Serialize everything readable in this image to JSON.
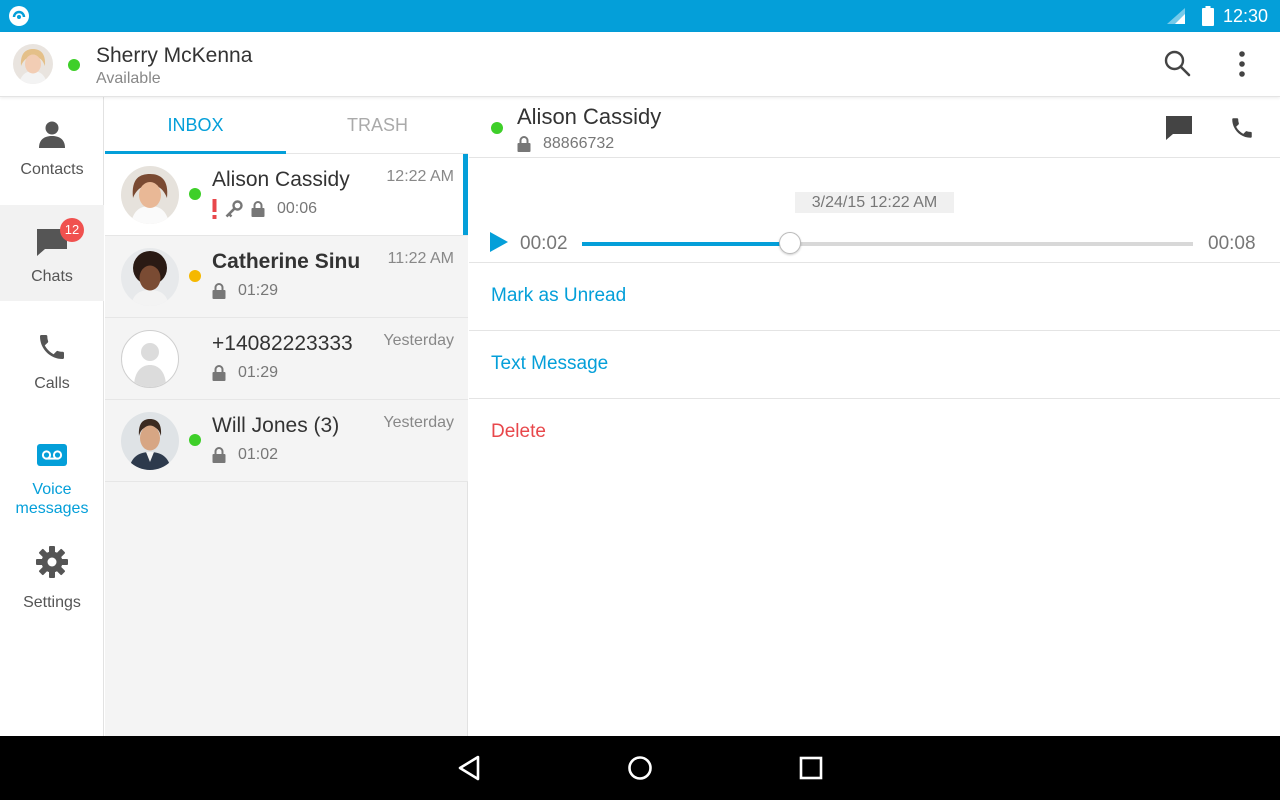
{
  "status_bar": {
    "time": "12:30",
    "app_logo_icon": "app-logo-icon",
    "signal_icon": "signal-icon",
    "battery_icon": "battery-icon"
  },
  "header": {
    "user_name": "Sherry McKenna",
    "user_status": "Available",
    "presence_color": "#3ecf29",
    "search_icon": "search-icon",
    "menu_icon": "overflow-menu-icon"
  },
  "nav": {
    "contacts": "Contacts",
    "chats": "Chats",
    "chats_badge": "12",
    "calls": "Calls",
    "voice_line1": "Voice",
    "voice_line2": "messages",
    "settings": "Settings"
  },
  "tabs": {
    "inbox": "INBOX",
    "trash": "TRASH",
    "active": "INBOX"
  },
  "messages": [
    {
      "name": "Alison Cassidy",
      "time": "12:22 AM",
      "duration": "00:06",
      "presence": "#3ecf29",
      "urgent": true,
      "private": true,
      "selected": true,
      "unread": false
    },
    {
      "name": "Catherine Sinu",
      "time": "11:22 AM",
      "duration": "01:29",
      "presence": "#f5b800",
      "urgent": false,
      "private": false,
      "selected": false,
      "unread": true
    },
    {
      "name": "+14082223333",
      "time": "Yesterday",
      "duration": "01:29",
      "presence": "",
      "urgent": false,
      "private": false,
      "selected": false,
      "unread": false
    },
    {
      "name": "Will Jones (3)",
      "time": "Yesterday",
      "duration": "01:02",
      "presence": "#3ecf29",
      "urgent": false,
      "private": false,
      "selected": false,
      "unread": false
    }
  ],
  "detail": {
    "name": "Alison Cassidy",
    "number": "88866732",
    "timestamp": "3/24/15 12:22 AM",
    "current_time": "00:02",
    "total_time": "00:08",
    "progress": 0.34,
    "actions": {
      "mark_unread": "Mark as Unread",
      "text_message": "Text Message",
      "delete": "Delete"
    }
  },
  "colors": {
    "accent": "#049fd9",
    "danger": "#e8474b",
    "urgent": "#e8474b"
  }
}
